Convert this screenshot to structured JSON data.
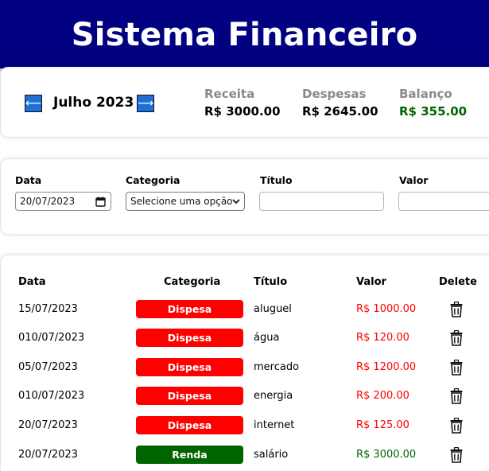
{
  "header": {
    "title": "Sistema Financeiro"
  },
  "month_nav": {
    "prev_icon": "arrow-left-icon",
    "next_icon": "arrow-right-icon",
    "prev_glyph": "⟵",
    "next_glyph": "⟶",
    "month": "Julho 2023"
  },
  "summary": {
    "income_label": "Receita",
    "income_value": "R$ 3000.00",
    "expense_label": "Despesas",
    "expense_value": "R$ 2645.00",
    "balance_label": "Balanço",
    "balance_value": "R$ 355.00"
  },
  "form": {
    "date_label": "Data",
    "date_value": "20/07/2023",
    "category_label": "Categoria",
    "category_value": "Selecione uma opção",
    "title_label": "Título",
    "title_value": "",
    "value_label": "Valor",
    "value_value": ""
  },
  "table": {
    "headers": {
      "date": "Data",
      "category": "Categoria",
      "title": "Título",
      "value": "Valor",
      "delete": "Delete"
    },
    "rows": [
      {
        "date": "15/07/2023",
        "category": "Dispesa",
        "title": "aluguel",
        "value": "R$ 1000.00"
      },
      {
        "date": "010/07/2023",
        "category": "Dispesa",
        "title": "água",
        "value": "R$ 120.00"
      },
      {
        "date": "05/07/2023",
        "category": "Dispesa",
        "title": "mercado",
        "value": "R$ 1200.00"
      },
      {
        "date": "010/07/2023",
        "category": "Dispesa",
        "title": "energia",
        "value": "R$ 200.00"
      },
      {
        "date": "20/07/2023",
        "category": "Dispesa",
        "title": "internet",
        "value": "R$ 125.00"
      },
      {
        "date": "20/07/2023",
        "category": "Renda",
        "title": "salário",
        "value": "R$ 3000.00"
      }
    ]
  },
  "colors": {
    "header_bg": "#000080",
    "expense": "#ff0000",
    "income": "#006400",
    "nav_button": "#1f6fd6"
  }
}
